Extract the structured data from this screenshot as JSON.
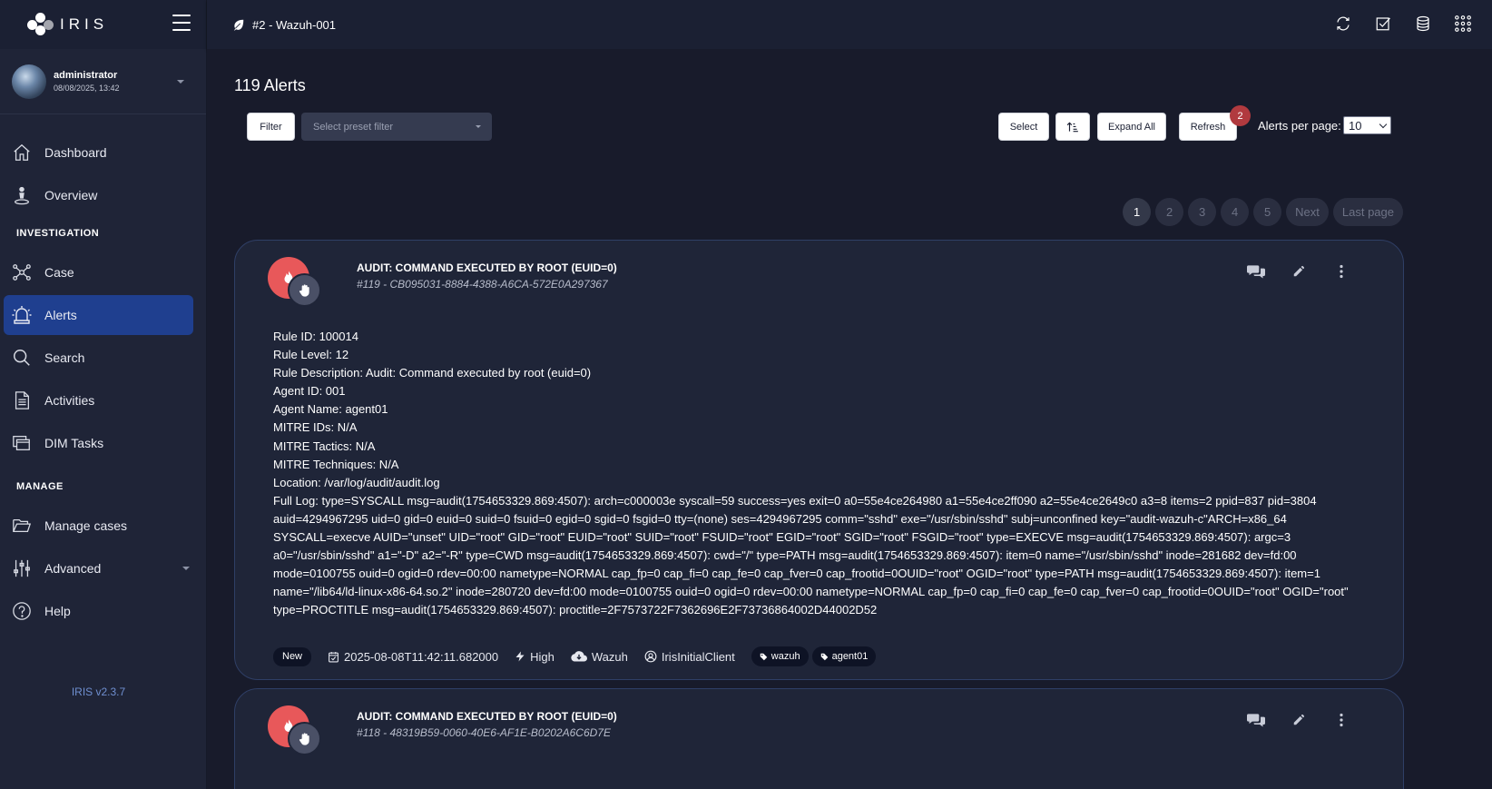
{
  "app": {
    "brand": "IRIS",
    "version": "IRIS v2.3.7"
  },
  "user": {
    "name": "administrator",
    "datetime": "08/08/2025, 13:42"
  },
  "sidebar": {
    "items": [
      {
        "label": "Dashboard"
      },
      {
        "label": "Overview"
      }
    ],
    "section_investigation": "INVESTIGATION",
    "investigation_items": [
      {
        "label": "Case"
      },
      {
        "label": "Alerts"
      },
      {
        "label": "Search"
      },
      {
        "label": "Activities"
      },
      {
        "label": "DIM Tasks"
      }
    ],
    "section_manage": "MANAGE",
    "manage_items": [
      {
        "label": "Manage cases"
      },
      {
        "label": "Advanced"
      },
      {
        "label": "Help"
      }
    ]
  },
  "topbar": {
    "case": "#2 - Wazuh-001"
  },
  "main": {
    "title": "119 Alerts",
    "filter_label": "Filter",
    "preset_placeholder": "Select preset filter",
    "select_label": "Select",
    "expand_all_label": "Expand All",
    "refresh_label": "Refresh",
    "refresh_badge": "2",
    "per_page_label": "Alerts per page:",
    "per_page_value": "10",
    "pagination": [
      "1",
      "2",
      "3",
      "4",
      "5",
      "Next",
      "Last page"
    ]
  },
  "alerts": [
    {
      "title": "AUDIT: COMMAND EXECUTED BY ROOT (EUID=0)",
      "subtitle": "#119 - CB095031-8884-4388-A6CA-572E0A297367",
      "lines": [
        "Rule ID: 100014",
        "Rule Level: 12",
        "Rule Description: Audit: Command executed by root (euid=0)",
        "Agent ID: 001",
        "Agent Name: agent01",
        "MITRE IDs: N/A",
        "MITRE Tactics: N/A",
        "MITRE Techniques: N/A",
        "Location: /var/log/audit/audit.log"
      ],
      "full_log": "Full Log: type=SYSCALL msg=audit(1754653329.869:4507): arch=c000003e syscall=59 success=yes exit=0 a0=55e4ce264980 a1=55e4ce2ff090 a2=55e4ce2649c0 a3=8 items=2 ppid=837 pid=3804 auid=4294967295 uid=0 gid=0 euid=0 suid=0 fsuid=0 egid=0 sgid=0 fsgid=0 tty=(none) ses=4294967295 comm=\"sshd\" exe=\"/usr/sbin/sshd\" subj=unconfined key=\"audit-wazuh-c\"ARCH=x86_64 SYSCALL=execve AUID=\"unset\" UID=\"root\" GID=\"root\" EUID=\"root\" SUID=\"root\" FSUID=\"root\" EGID=\"root\" SGID=\"root\" FSGID=\"root\" type=EXECVE msg=audit(1754653329.869:4507): argc=3 a0=\"/usr/sbin/sshd\" a1=\"-D\" a2=\"-R\" type=CWD msg=audit(1754653329.869:4507): cwd=\"/\" type=PATH msg=audit(1754653329.869:4507): item=0 name=\"/usr/sbin/sshd\" inode=281682 dev=fd:00 mode=0100755 ouid=0 ogid=0 rdev=00:00 nametype=NORMAL cap_fp=0 cap_fi=0 cap_fe=0 cap_fver=0 cap_frootid=0OUID=\"root\" OGID=\"root\" type=PATH msg=audit(1754653329.869:4507): item=1 name=\"/lib64/ld-linux-x86-64.so.2\" inode=280720 dev=fd:00 mode=0100755 ouid=0 ogid=0 rdev=00:00 nametype=NORMAL cap_fp=0 cap_fi=0 cap_fe=0 cap_fver=0 cap_frootid=0OUID=\"root\" OGID=\"root\" type=PROCTITLE msg=audit(1754653329.869:4507): proctitle=2F7573722F7362696E2F73736864002D44002D52",
      "status": "New",
      "timestamp": "2025-08-08T11:42:11.682000",
      "severity": "High",
      "source": "Wazuh",
      "client": "IrisInitialClient",
      "tags": [
        "wazuh",
        "agent01"
      ]
    },
    {
      "title": "AUDIT: COMMAND EXECUTED BY ROOT (EUID=0)",
      "subtitle": "#118 - 48319B59-0060-40E6-AF1E-B0202A6C6D7E"
    }
  ],
  "colors": {
    "accent": "#1f3f8f",
    "alert_red": "#e8585a",
    "badge_red": "#b13a3f",
    "link_blue": "#6f8fd0"
  }
}
